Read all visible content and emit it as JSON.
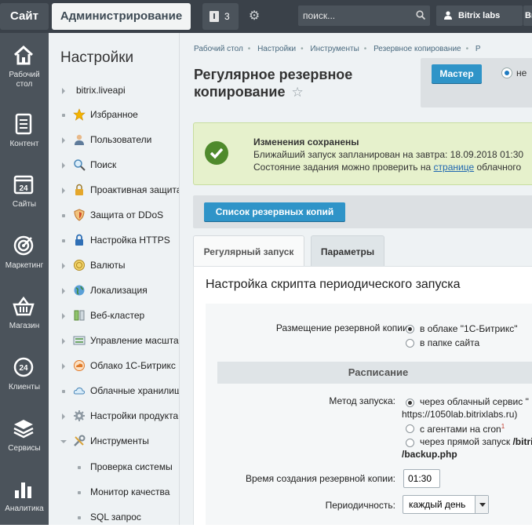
{
  "topbar": {
    "site_label": "Сайт",
    "admin_label": "Администрирование",
    "notifications_count": "3",
    "search_placeholder": "поиск...",
    "user_name": "Bitrix labs",
    "lang": "Ви"
  },
  "leftbar": {
    "items": [
      {
        "label": "Рабочий стол",
        "icon": "home-icon"
      },
      {
        "label": "Контент",
        "icon": "document-icon"
      },
      {
        "label": "Сайты",
        "icon": "calendar-icon"
      },
      {
        "label": "Маркетинг",
        "icon": "target-icon"
      },
      {
        "label": "Магазин",
        "icon": "basket-icon"
      },
      {
        "label": "Клиенты",
        "icon": "clients-icon"
      },
      {
        "label": "Сервисы",
        "icon": "layers-icon"
      },
      {
        "label": "Аналитика",
        "icon": "chart-icon"
      }
    ],
    "calendar_number": "24",
    "clients_number": "24"
  },
  "menu": {
    "title": "Настройки",
    "items": [
      {
        "label": "bitrix.liveapi"
      },
      {
        "label": "Избранное"
      },
      {
        "label": "Пользователи"
      },
      {
        "label": "Поиск"
      },
      {
        "label": "Проактивная защита"
      },
      {
        "label": "Защита от DDoS"
      },
      {
        "label": "Настройка HTTPS"
      },
      {
        "label": "Валюты"
      },
      {
        "label": "Локализация"
      },
      {
        "label": "Веб-кластер"
      },
      {
        "label": "Управление масштабированием"
      },
      {
        "label": "Облако 1С-Битрикс"
      },
      {
        "label": "Облачные хранилища"
      },
      {
        "label": "Настройки продукта"
      },
      {
        "label": "Инструменты"
      },
      {
        "label": "Проверка системы"
      },
      {
        "label": "Монитор качества"
      },
      {
        "label": "SQL запрос"
      }
    ]
  },
  "breadcrumb": [
    "Рабочий стол",
    "Настройки",
    "Инструменты",
    "Резервное копирование",
    "Р"
  ],
  "page": {
    "title_line1": "Регулярное резервное",
    "title_line2": "копирование",
    "master_label": "Мастер",
    "ne_label": "не"
  },
  "success": {
    "title": "Изменения сохранены",
    "line2": "Ближайший запуск запланирован на завтра: 18.09.2018 01:30",
    "line3_pre": "Состояние задания можно проверить на ",
    "line3_link": "странице",
    "line3_post": " облачного"
  },
  "list_button": "Список резервных копий",
  "tabs": [
    "Регулярный запуск",
    "Параметры"
  ],
  "form": {
    "heading": "Настройка скрипта периодического запуска",
    "placement_label": "Размещение резервной копии:",
    "placement_options": [
      "в облаке \"1С-Битрикс\"",
      "в папке сайта"
    ],
    "schedule_header": "Расписание",
    "method_label": "Метод запуска:",
    "method_opt1_a": "через облачный сервис \"",
    "method_opt1_b": "https://1050lab.bitrixlabs.ru)",
    "method_opt2": "с агентами на cron",
    "method_opt2_sup": "1",
    "method_opt3_a": "через прямой запуск ",
    "method_opt3_b": "/bitri",
    "method_opt3_c": "/backup.php",
    "time_label": "Время создания резервной копии:",
    "time_value": "01:30",
    "period_label": "Периодичность:",
    "period_value": "каждый день"
  }
}
